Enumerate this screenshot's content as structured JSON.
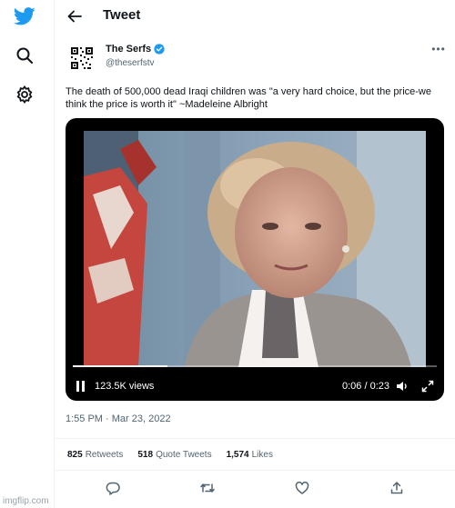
{
  "nav": {
    "items": [
      {
        "icon": "twitter-logo-icon"
      },
      {
        "icon": "search-icon"
      },
      {
        "icon": "settings-icon"
      }
    ],
    "brand_color": "#1d9bf0"
  },
  "header": {
    "title": "Tweet"
  },
  "tweet": {
    "author": {
      "display_name": "The Serfs",
      "handle": "@theserfstv",
      "verified": true
    },
    "text": "The death of 500,000 dead Iraqi children was \"a very hard choice, but the price-we think the price is worth it\" ~Madeleine Albright",
    "video": {
      "views": "123.5K views",
      "time": "0:06 / 0:23",
      "progress": 0.26,
      "playing": true
    },
    "timestamp": "1:55 PM · Mar 23, 2022",
    "stats": {
      "retweets_count": "825",
      "retweets_label": "Retweets",
      "quotes_count": "518",
      "quotes_label": "Quote Tweets",
      "likes_count": "1,574",
      "likes_label": "Likes"
    },
    "actions": [
      {
        "icon": "reply-icon"
      },
      {
        "icon": "retweet-icon"
      },
      {
        "icon": "like-icon"
      },
      {
        "icon": "share-icon"
      }
    ]
  },
  "watermark": "imgflip.com"
}
